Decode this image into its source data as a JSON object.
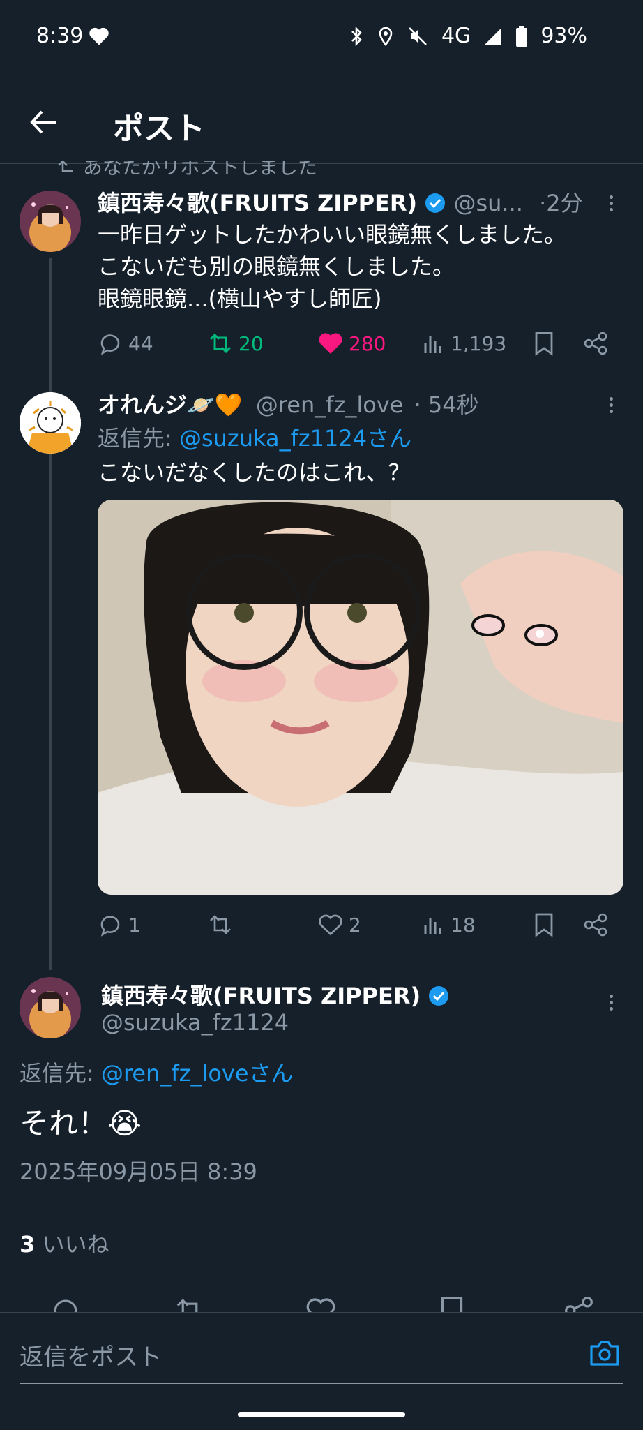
{
  "status_bar": {
    "time": "8:39",
    "network": "4G",
    "battery": "93%"
  },
  "header": {
    "title": "ポスト"
  },
  "retweet_note": "あなたがリポストしました",
  "tweet1": {
    "name": "鎮西寿々歌(FRUITS ZIPPER)",
    "handle": "@su...",
    "time": "·2分",
    "lines": [
      "一昨日ゲットしたかわいい眼鏡無くしました。",
      "こないだも別の眼鏡無くしました。",
      "眼鏡眼鏡...(横山やすし師匠)"
    ],
    "replies": "44",
    "reposts": "20",
    "likes": "280",
    "views": "1,193"
  },
  "tweet2": {
    "name": "オれんジ",
    "name_emoji": "🪐🧡",
    "handle": "@ren_fz_love",
    "time": "· 54秒",
    "reply_prefix": "返信先: ",
    "reply_to": "@suzuka_fz1124さん",
    "text": "こないだなくしたのはこれ、？",
    "replies": "1",
    "likes": "2",
    "views": "18"
  },
  "main_tweet": {
    "name": "鎮西寿々歌(FRUITS ZIPPER)",
    "handle": "@suzuka_fz1124",
    "reply_prefix": "返信先: ",
    "reply_to": "@ren_fz_loveさん",
    "text": "それ！😭",
    "timestamp": "2025年09月05日 8:39",
    "likes_count": "3",
    "likes_label": "いいね"
  },
  "reply_box": {
    "placeholder": "返信をポスト"
  },
  "colors": {
    "background": "#15202b",
    "accent": "#1d9bf0",
    "retweet_green": "#00ba7c",
    "like_pink": "#f91880",
    "muted": "#8b98a5"
  }
}
